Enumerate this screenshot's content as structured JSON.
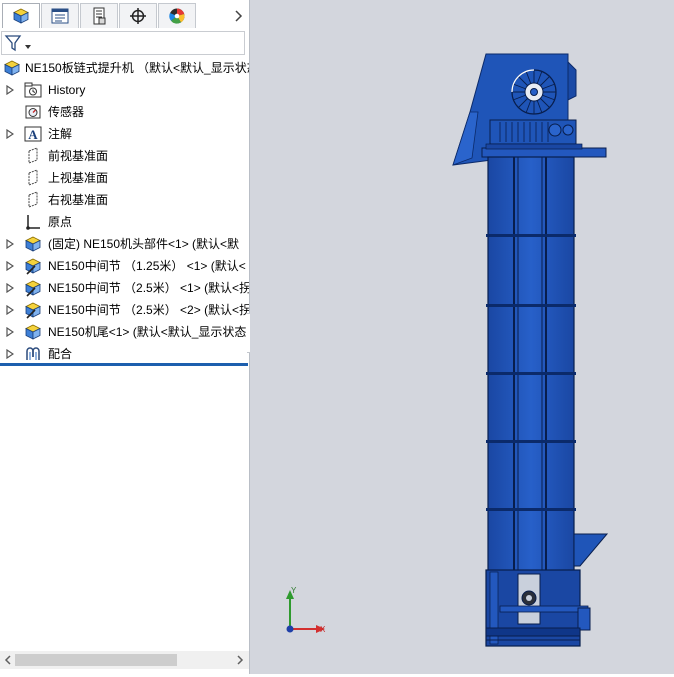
{
  "tabs": [
    {
      "name": "feature-manager-tab",
      "icon": "feature-manager-icon",
      "active": true
    },
    {
      "name": "property-manager-tab",
      "icon": "property-manager-icon",
      "active": false
    },
    {
      "name": "configuration-manager-tab",
      "icon": "configuration-manager-icon",
      "active": false
    },
    {
      "name": "dimxpert-tab",
      "icon": "crosshair-icon",
      "active": false
    },
    {
      "name": "display-manager-tab",
      "icon": "color-wheel-icon",
      "active": false
    }
  ],
  "filter": {
    "icon": "filter-icon"
  },
  "tree": {
    "root": "NE150板链式提升机 （默认<默认_显示状态",
    "items": [
      {
        "label": "History",
        "icon": "history-folder-icon",
        "expander": true
      },
      {
        "label": "传感器",
        "icon": "sensor-icon",
        "expander": false
      },
      {
        "label": "注解",
        "icon": "annotation-icon",
        "expander": true
      },
      {
        "label": "前视基准面",
        "icon": "plane-icon",
        "expander": false
      },
      {
        "label": "上视基准面",
        "icon": "plane-icon",
        "expander": false
      },
      {
        "label": "右视基准面",
        "icon": "plane-icon",
        "expander": false
      },
      {
        "label": "原点",
        "icon": "origin-icon",
        "expander": false
      },
      {
        "label": "(固定) NE150机头部件<1> (默认<默",
        "icon": "subassembly-icon",
        "expander": true
      },
      {
        "label": "NE150中间节 （1.25米） <1> (默认<",
        "icon": "subassembly-edit-icon",
        "expander": true
      },
      {
        "label": "NE150中间节 （2.5米） <1> (默认<拐",
        "icon": "subassembly-edit-icon",
        "expander": true
      },
      {
        "label": "NE150中间节 （2.5米） <2> (默认<拐",
        "icon": "subassembly-edit-icon",
        "expander": true
      },
      {
        "label": "NE150机尾<1> (默认<默认_显示状态",
        "icon": "subassembly-icon",
        "expander": true
      },
      {
        "label": "配合",
        "icon": "mates-icon",
        "expander": true
      }
    ]
  },
  "triad": {
    "x_label": "X",
    "y_label": "Y"
  },
  "colors": {
    "machine_blue": "#1f55b8",
    "viewport_bg": "#d3d6dd",
    "selection_line": "#1d5fae"
  }
}
